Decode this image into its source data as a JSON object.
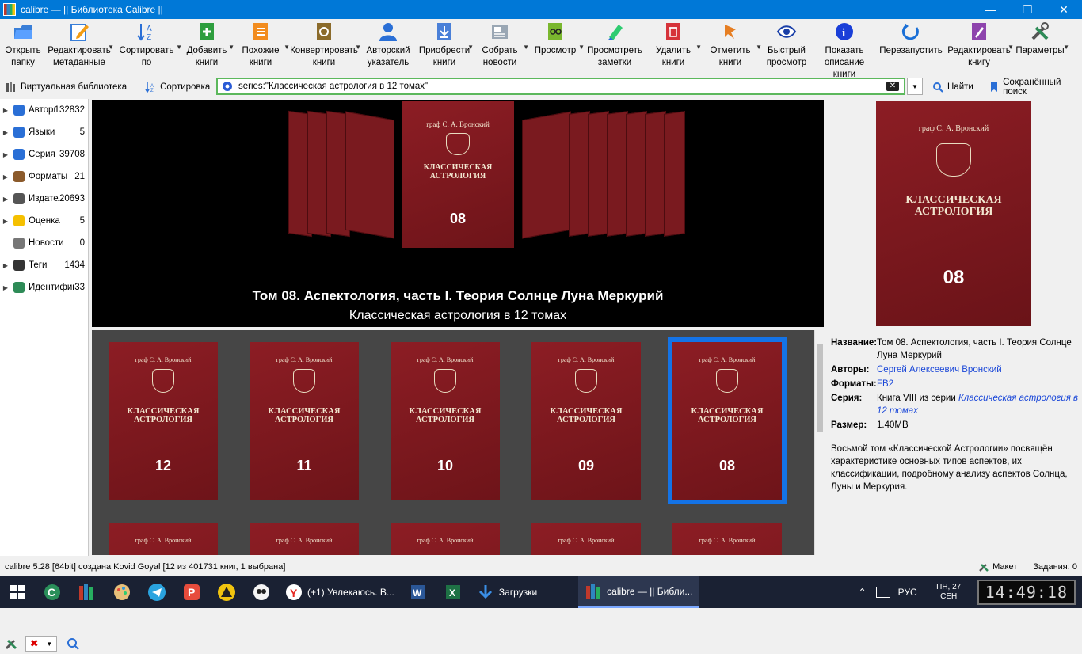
{
  "window": {
    "title": "calibre — || Библиотека Calibre ||",
    "minimize": "—",
    "maximize": "❐",
    "close": "✕"
  },
  "toolbar": {
    "open_lib": "Открыть\nпапку",
    "edit_meta": "Редактировать\nметаданные",
    "sort": "Сортировать\nпо",
    "add_books": "Добавить\nкниги",
    "similar": "Похожие\nкниги",
    "convert": "Конвертировать\nкниги",
    "author_index": "Авторский\nуказатель",
    "get_books": "Приобрести\nкниги",
    "fetch_news": "Собрать\nновости",
    "view": "Просмотр",
    "notes": "Просмотреть\nзаметки",
    "remove": "Удалить\nкниги",
    "mark": "Отметить\nкниги",
    "quickview": "Быстрый\nпросмотр",
    "show_desc": "Показать\nописание книги",
    "restart": "Перезапустить",
    "edit_book": "Редактировать\nкнигу",
    "prefs": "Параметры"
  },
  "searchbar": {
    "virtual_library": "Виртуальная библиотека",
    "sort": "Сортировка",
    "query": "series:\"Классическая астрология в 12 томах\"",
    "find": "Найти",
    "saved_search": "Сохранённый поиск"
  },
  "tag_browser": [
    {
      "name": "Авторы",
      "count": "132832",
      "icon": "person-icon",
      "color": "#2a6fd6"
    },
    {
      "name": "Языки",
      "count": "5",
      "icon": "language-icon",
      "color": "#2a6fd6"
    },
    {
      "name": "Серия",
      "count": "39708",
      "icon": "series-icon",
      "color": "#2a6fd6"
    },
    {
      "name": "Форматы",
      "count": "21",
      "icon": "book-icon",
      "color": "#8b5a2b"
    },
    {
      "name": "Издатели",
      "count": "20693",
      "icon": "publisher-icon",
      "color": "#555555"
    },
    {
      "name": "Оценка",
      "count": "5",
      "icon": "star-icon",
      "color": "#f5c000"
    },
    {
      "name": "Новости",
      "count": "0",
      "icon": "news-icon",
      "color": "#777777"
    },
    {
      "name": "Теги",
      "count": "1434",
      "icon": "tag-icon",
      "color": "#333333"
    },
    {
      "name": "Идентификаторы",
      "count": "33",
      "icon": "barcode-icon",
      "color": "#2e8b57"
    }
  ],
  "cover_flow": {
    "title": "Том 08. Аспектология, часть I. Теория Солнце Луна Меркурий",
    "series": "Классическая астрология в 12 томах",
    "center_author": "граф С. А. Вронский",
    "center_book_title": "КЛАССИЧЕСКАЯ\nАСТРОЛОГИЯ",
    "center_number": "08"
  },
  "grid": {
    "author": "граф С. А. Вронский",
    "book_title": "КЛАССИЧЕСКАЯ\nАСТРОЛОГИЯ",
    "books": [
      {
        "number": "12"
      },
      {
        "number": "11"
      },
      {
        "number": "10"
      },
      {
        "number": "09"
      },
      {
        "number": "08"
      }
    ]
  },
  "details": {
    "cover_author": "граф С. А. Вронский",
    "cover_title": "КЛАССИЧЕСКАЯ\nАСТРОЛОГИЯ",
    "cover_number": "08",
    "title_label": "Название:",
    "title_value": "Том 08. Аспектология, часть I. Теория Солнце Луна Меркурий",
    "authors_label": "Авторы:",
    "authors_value": "Сергей Алексеевич Вронский",
    "formats_label": "Форматы:",
    "formats_value": "FB2",
    "series_label": "Серия:",
    "series_prefix": "Книга VIII из серии ",
    "series_value": "Классическая астрология в 12 томах",
    "size_label": "Размер:",
    "size_value": "1.40MB",
    "description": "Восьмой том «Классической Астрологии» посвящён характеристике основных типов аспектов, их классификации, подробному анализу аспектов Солнца, Луны и Меркурия."
  },
  "status": {
    "left": "calibre 5.28 [64bit] создана Kovid Goyal    [12 из 401731 книг, 1 выбрана]",
    "layout": "Макет",
    "jobs": "Задания: 0"
  },
  "taskbar": {
    "yandex": "(+1) Увлекаюсь. В...",
    "downloads": "Загрузки",
    "calibre": "calibre — || Библи...",
    "lang": "РУС",
    "day": "ПН, 27",
    "month": "СЕН",
    "time": "14:49:18"
  }
}
